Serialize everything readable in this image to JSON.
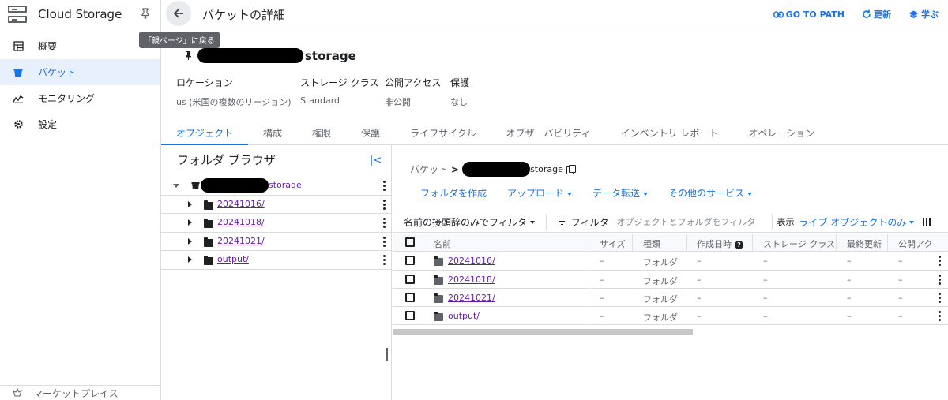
{
  "app": {
    "title": "Cloud Storage"
  },
  "sidebar": {
    "items": [
      {
        "label": "概要",
        "icon": "dashboard-icon",
        "active": false
      },
      {
        "label": "バケット",
        "icon": "bucket-icon",
        "active": true
      },
      {
        "label": "モニタリング",
        "icon": "monitoring-icon",
        "active": false
      },
      {
        "label": "設定",
        "icon": "gear-icon",
        "active": false
      }
    ],
    "bottom_label": "マーケットプレイス"
  },
  "header": {
    "title": "バケットの詳細",
    "back_tooltip": "「親ページ」に戻る",
    "actions": {
      "goto": "GO TO PATH",
      "refresh": "更新",
      "learn": "学ぶ"
    }
  },
  "bucket": {
    "name_suffix": "storage",
    "meta": [
      {
        "label": "ロケーション",
        "value": "us (米国の複数のリージョン)"
      },
      {
        "label": "ストレージ クラス",
        "value": "Standard"
      },
      {
        "label": "公開アクセス",
        "value": "非公開"
      },
      {
        "label": "保護",
        "value": "なし"
      }
    ]
  },
  "tabs": [
    "オブジェクト",
    "構成",
    "権限",
    "保護",
    "ライフサイクル",
    "オブザーバビリティ",
    "インベントリ レポート",
    "オペレーション"
  ],
  "folder_browser": {
    "title": "フォルダ ブラウザ",
    "root": "storage",
    "folders": [
      "20241016/",
      "20241018/",
      "20241021/",
      "output/"
    ]
  },
  "objects": {
    "breadcrumb_root": "バケット",
    "breadcrumb_bucket": "storage",
    "actions": {
      "create_folder": "フォルダを作成",
      "upload": "アップロード",
      "transfer": "データ転送",
      "other": "その他のサービス"
    },
    "filter": {
      "prefix_select": "名前の接頭辞のみでフィルタ",
      "filter_label": "フィルタ",
      "placeholder": "オブジェクトとフォルダをフィルタ",
      "show_label": "表示",
      "show_value": "ライブ オブジェクトのみ"
    },
    "columns": [
      "名前",
      "サイズ",
      "種類",
      "作成日時",
      "ストレージ クラス",
      "最終更新",
      "公開アク"
    ],
    "rows": [
      {
        "name": "20241016/",
        "size": "–",
        "type": "フォルダ",
        "created": "–",
        "class": "–",
        "updated": "–",
        "public": "–"
      },
      {
        "name": "20241018/",
        "size": "–",
        "type": "フォルダ",
        "created": "–",
        "class": "–",
        "updated": "–",
        "public": "–"
      },
      {
        "name": "20241021/",
        "size": "–",
        "type": "フォルダ",
        "created": "–",
        "class": "–",
        "updated": "–",
        "public": "–"
      },
      {
        "name": "output/",
        "size": "–",
        "type": "フォルダ",
        "created": "–",
        "class": "–",
        "updated": "–",
        "public": "–"
      }
    ]
  },
  "colors": {
    "accent": "#1a73e8",
    "link_visited": "#681da8",
    "active_bg": "#e8f0fe"
  }
}
